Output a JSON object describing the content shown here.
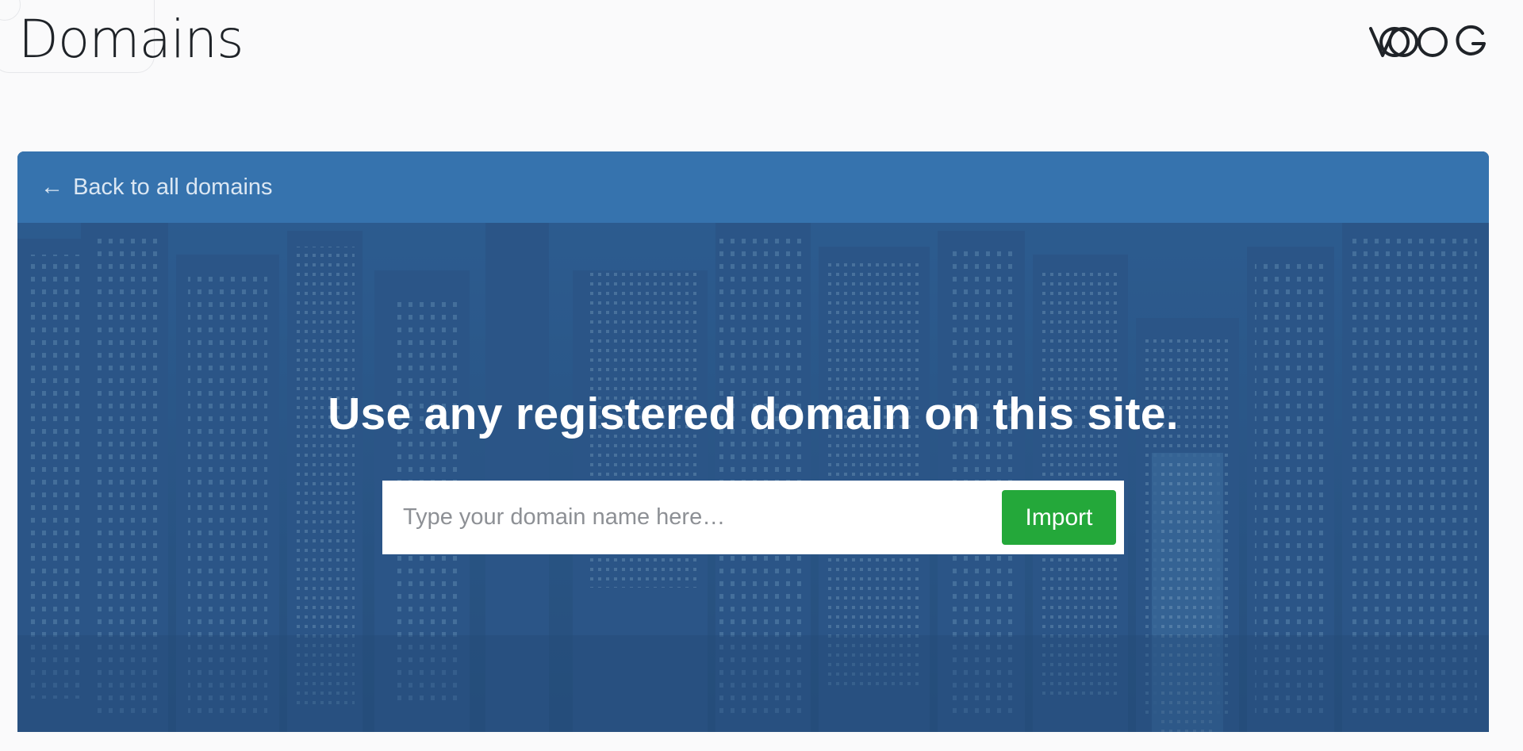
{
  "header": {
    "title": "Domains",
    "logo_text": "VOOG"
  },
  "panel": {
    "back_link": {
      "arrow": "←",
      "label": "Back to all domains"
    },
    "hero": {
      "headline": "Use any registered domain on this site.",
      "background": "city-skyline-night-photo",
      "input": {
        "placeholder": "Type your domain name here…",
        "value": ""
      },
      "import_button": {
        "label": "Import"
      }
    }
  },
  "colors": {
    "panel_header": "#3673ae",
    "hero_overlay": "#2f5f95",
    "import_button": "#24a83a",
    "page_background": "#fafafb"
  }
}
